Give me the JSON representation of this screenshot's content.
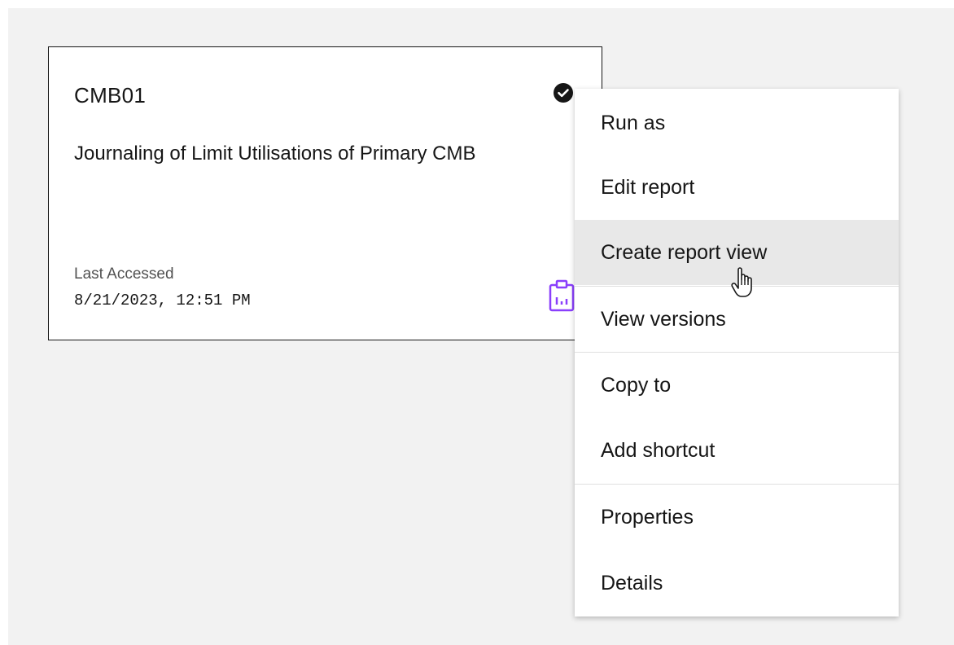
{
  "tile": {
    "title": "CMB01",
    "description": "Journaling of Limit Utilisations of Primary CMB",
    "last_accessed_label": "Last Accessed",
    "last_accessed_value": "8/21/2023, 12:51 PM",
    "check_icon": "checkmark-filled-icon",
    "type_icon": "report-icon",
    "type_icon_color": "#8a3ffc"
  },
  "menu": {
    "items": [
      {
        "label": "Run as"
      },
      {
        "label": "Edit report"
      },
      {
        "label": "Create report view"
      },
      {
        "label": "View versions"
      },
      {
        "label": "Copy to"
      },
      {
        "label": "Add shortcut"
      },
      {
        "label": "Properties"
      },
      {
        "label": "Details"
      }
    ],
    "hovered_item": "Create report view"
  },
  "colors": {
    "background": "#f2f2f2",
    "tile_border": "#161616",
    "hover": "#e8e8e8",
    "accent": "#8a3ffc"
  }
}
